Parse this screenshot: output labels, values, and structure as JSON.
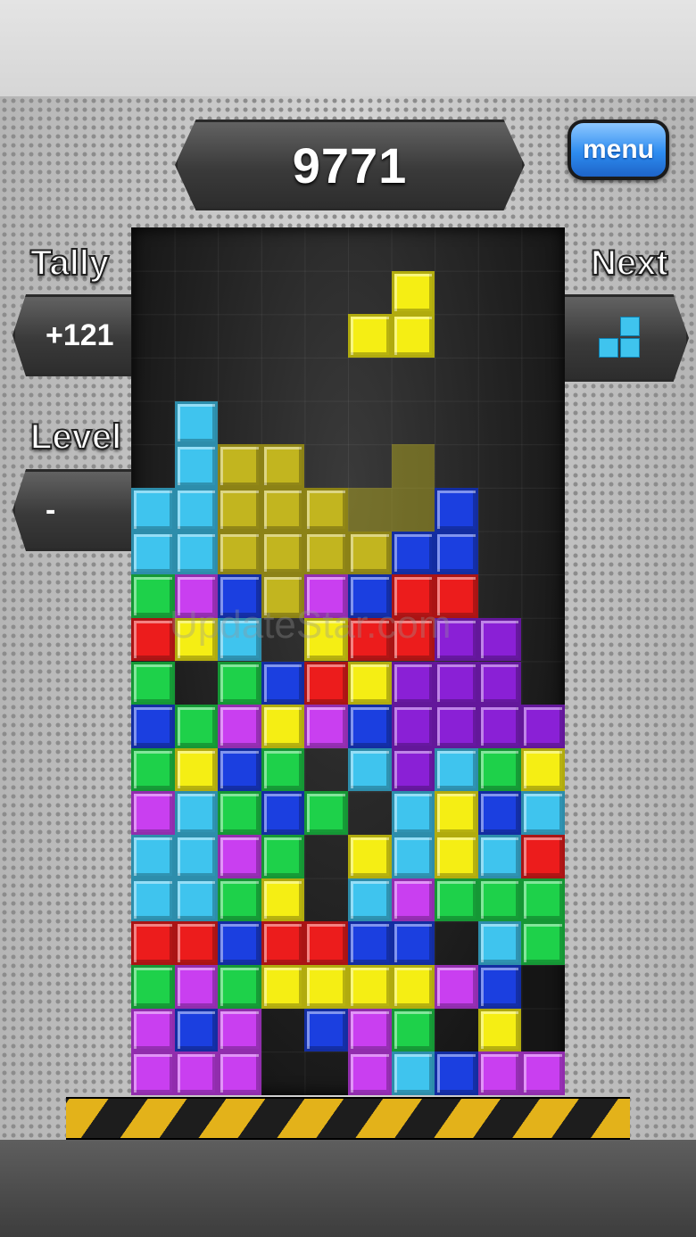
{
  "score": "9771",
  "menu_label": "menu",
  "tally": {
    "label": "Tally",
    "value": "+121"
  },
  "level": {
    "label": "Level",
    "value": "-"
  },
  "next": {
    "label": "Next",
    "piece": "L",
    "color": "#3fc4ee"
  },
  "watermark": "UpdateStar.com",
  "colors": {
    "C": "#3fc4ee",
    "B": "#1b3fe0",
    "G": "#1ed14a",
    "Y": "#f5ee14",
    "R": "#ec1c1c",
    "M": "#c93ff0",
    "P": "#8a20d6",
    "O": "#c2b51f"
  },
  "board": {
    "columns": 10,
    "rows": [
      "..........",
      "......Y...",
      ".....YY...",
      "..........",
      ".C........",
      ".COO..o...",
      "CCOOOooB..",
      "CCOOOOBB..",
      "GMBOMBRR..",
      "RYC.YRRPP.",
      "G.GBRYPPP.",
      "BGMYMBPPPP",
      "GYBG.CPCGY",
      "MCGBG.CYBC",
      "CCMG.YCYCR",
      "CCGY.CMGGG",
      "RRBRRBB.CG",
      "GMGYYYYMB.",
      "MBM.BMG.Y.",
      "MMM..MCBMM"
    ]
  }
}
